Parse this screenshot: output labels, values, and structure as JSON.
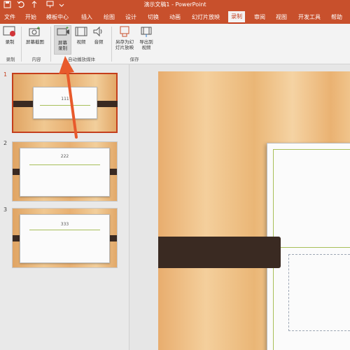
{
  "titlebar": {
    "title": "演示文稿1 - PowerPoint"
  },
  "menu": {
    "tabs": [
      "文件",
      "开始",
      "模板中心",
      "插入",
      "绘图",
      "设计",
      "切换",
      "动画",
      "幻灯片放映",
      "录制",
      "审阅",
      "视图",
      "开发工具",
      "帮助"
    ],
    "active_tab": "录制"
  },
  "ribbon": {
    "buttons": {
      "record": "录制",
      "screenshot": "屏幕截图",
      "screen_record": "屏幕录制",
      "video": "视频",
      "audio": "音频",
      "save_as_show": "另存为幻灯片放映",
      "export_video": "导出到视频"
    },
    "groups": {
      "record": "录制",
      "content": "内容",
      "auto_media": "自动播放媒体",
      "save": "保存"
    }
  },
  "thumbnails": [
    {
      "number": "1",
      "text": "111"
    },
    {
      "number": "2",
      "text": "222"
    },
    {
      "number": "3",
      "text": "333"
    }
  ],
  "colors": {
    "accent": "#c8502c",
    "annotation_arrow": "#e85a2c"
  }
}
